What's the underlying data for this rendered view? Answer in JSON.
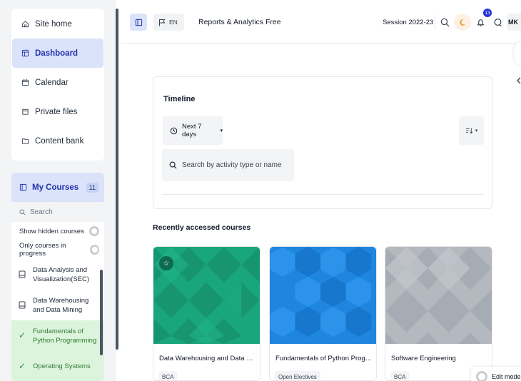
{
  "nav": {
    "items": [
      {
        "label": "Site home",
        "icon": "home-icon"
      },
      {
        "label": "Dashboard",
        "icon": "dashboard-icon"
      },
      {
        "label": "Calendar",
        "icon": "calendar-icon"
      },
      {
        "label": "Private files",
        "icon": "file-icon"
      },
      {
        "label": "Content bank",
        "icon": "folder-icon"
      }
    ],
    "active_item": "Dashboard"
  },
  "my_courses": {
    "title": "My Courses",
    "count": "11",
    "search_placeholder": "Search",
    "show_hidden_label": "Show hidden courses",
    "only_in_progress_label": "Only courses in progress",
    "items": [
      {
        "label": "Data Analysis and Visualization(SEC)",
        "done": false
      },
      {
        "label": "Data Warehousing and Data Mining",
        "done": false
      },
      {
        "label": "Fundamentals of Python Programming",
        "done": true
      },
      {
        "label": "Operating Systems",
        "done": true
      }
    ]
  },
  "topbar": {
    "lang": "EN",
    "brand": "Reports & Analytics Free",
    "session": "Session 2022-23",
    "notification_count": "13",
    "avatar_initials": "MK"
  },
  "timeline": {
    "title": "Timeline",
    "filter_label": "Next 7 days",
    "search_placeholder": "Search by activity type or name"
  },
  "recent": {
    "title": "Recently accessed courses",
    "courses": [
      {
        "name": "Data Warehousing and Data Mining",
        "category": "BCA",
        "color": "#1aa67c",
        "starred": true
      },
      {
        "name": "Fundamentals of Python Programmi...",
        "category": "Open Electives",
        "color": "#1f86e0",
        "starred": false
      },
      {
        "name": "Software Engineering",
        "category": "BCA",
        "color": "#b4b9bf",
        "starred": false
      }
    ]
  },
  "edit_mode_label": "Edit mode",
  "colors": {
    "accent": "#2332a8",
    "active_bg": "#dbe3fb",
    "done_bg": "#dcf3dc",
    "badge": "#2337d8",
    "moon_icon": "#f0a23b"
  }
}
